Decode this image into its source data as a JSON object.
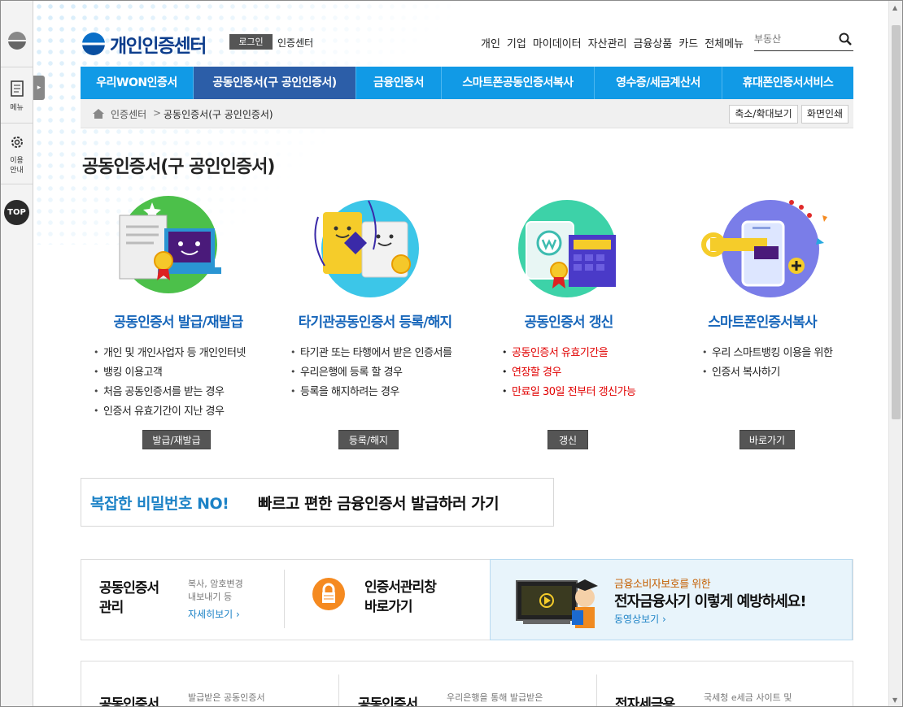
{
  "sidebar": {
    "menu_label": "메뉴",
    "guide_label1": "이용",
    "guide_label2": "안내",
    "top_label": "TOP"
  },
  "header": {
    "logo_text": "개인인증센터",
    "login_label": "로그인",
    "cert_center_label": "인증센터",
    "gnb": [
      "개인",
      "기업",
      "마이데이터",
      "자산관리",
      "금융상품",
      "카드",
      "전체메뉴"
    ],
    "search_placeholder": "부동산"
  },
  "tabs": [
    {
      "label": "우리WON인증서",
      "active": false
    },
    {
      "label": "공동인증서(구 공인인증서)",
      "active": true
    },
    {
      "label": "금융인증서",
      "active": false
    },
    {
      "label": "스마트폰공동인증서복사",
      "active": false
    },
    {
      "label": "영수증/세금계산서",
      "active": false
    },
    {
      "label": "휴대폰인증서서비스",
      "active": false
    }
  ],
  "breadcrumb": {
    "home": "인증센터",
    "separator": ">",
    "current": "공동인증서(구 공인인증서)",
    "zoom_label": "축소/확대보기",
    "print_label": "화면인쇄"
  },
  "page_title": "공동인증서(구 공인인증서)",
  "services": [
    {
      "title": "공동인증서 발급/재발급",
      "items": [
        "개인 및 개인사업자 등 개인인터넷",
        "뱅킹 이용고객",
        "처음 공동인증서를 받는 경우",
        "인증서 유효기간이 지난 경우"
      ],
      "button": "발급/재발급"
    },
    {
      "title": "타기관공동인증서 등록/해지",
      "items": [
        "타기관 또는 타행에서 받은 인증서를",
        "우리은행에 등록 할 경우",
        "등록을 해지하려는 경우"
      ],
      "button": "등록/해지"
    },
    {
      "title": "공동인증서 갱신",
      "items": [
        "공동인증서 유효기간을",
        "연장할 경우",
        "만료일 30일 전부터 갱신가능"
      ],
      "button": "갱신"
    },
    {
      "title": "스마트폰인증서복사",
      "items": [
        "우리 스마트뱅킹 이용을 위한",
        "인증서 복사하기"
      ],
      "button": "바로가기"
    }
  ],
  "banner": {
    "highlight": "복잡한 비밀번호 NO!",
    "text": "빠르고 편한 금융인증서 발급하러 가기"
  },
  "manage": {
    "title1": "공동인증서",
    "title2": "관리",
    "desc1": "복사, 암호변경",
    "desc2": "내보내기 등",
    "link": "자세히보기 ›",
    "window_title1": "인증서관리창",
    "window_title2": "바로가기"
  },
  "promo": {
    "subtitle": "금융소비자보호를 위한",
    "title": "전자금융사기 이렇게 예방하세요!",
    "link": "동영상보기 ›"
  },
  "bottom": [
    {
      "title": "공동인증서",
      "desc": "발급받은 공동인증서"
    },
    {
      "title": "공동인증서",
      "desc": "우리은행을 통해 발급받은"
    },
    {
      "title": "전자세금용",
      "desc": "국세청 e세금 사이트 및"
    }
  ],
  "colors": {
    "tab_bg": "#119ae6",
    "tab_active": "#2c5ea8",
    "title_blue": "#1766ba",
    "red": "#e10000"
  }
}
